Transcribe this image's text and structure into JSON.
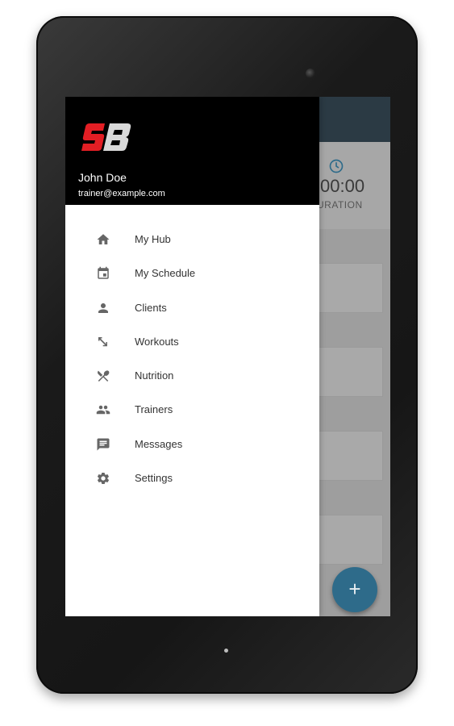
{
  "colors": {
    "drawer_header_bg": "#000000",
    "logo_red": "#e31e24",
    "logo_gray": "#d9d9d9",
    "app_bar": "#2b3a44",
    "fab": "#2e6b8a",
    "accent_icon": "#2e6b8a"
  },
  "drawer": {
    "logo_icon": "sb-logo",
    "user": {
      "name": "John Doe",
      "email": "trainer@example.com"
    },
    "items": [
      {
        "label": "My Hub",
        "icon": "home-icon"
      },
      {
        "label": "My Schedule",
        "icon": "calendar-icon"
      },
      {
        "label": "Clients",
        "icon": "person-icon"
      },
      {
        "label": "Workouts",
        "icon": "arrows-diagonal-icon"
      },
      {
        "label": "Nutrition",
        "icon": "utensils-icon"
      },
      {
        "label": "Trainers",
        "icon": "people-icon"
      },
      {
        "label": "Messages",
        "icon": "message-icon"
      },
      {
        "label": "Settings",
        "icon": "gear-icon"
      }
    ]
  },
  "background": {
    "duration_value": "00:00",
    "duration_label": "URATION",
    "fab_label": "+"
  }
}
